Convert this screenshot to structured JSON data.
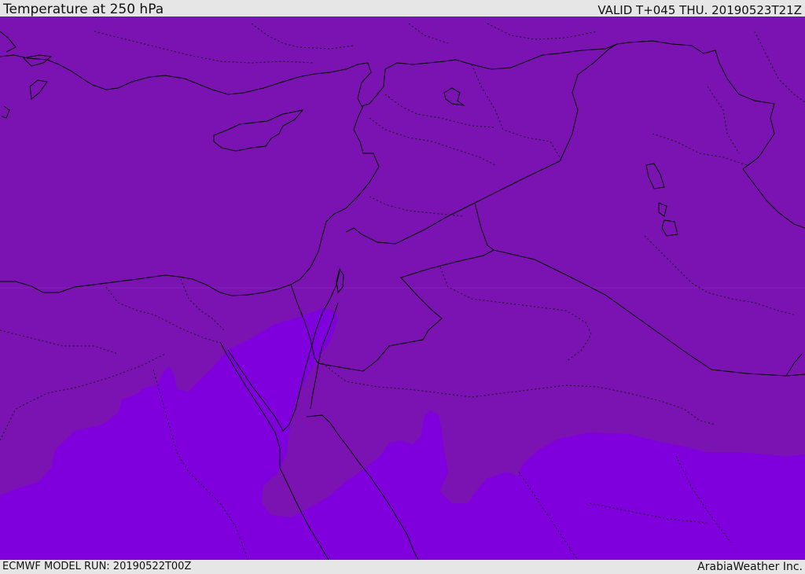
{
  "header": {
    "title": "Temperature at 250 hPa",
    "valid_time": "VALID T+045 THU. 20190523T21Z"
  },
  "footer": {
    "model_run": "ECMWF MODEL RUN: 20190522T00Z",
    "credit": "ArabiaWeather Inc."
  },
  "map": {
    "colors": {
      "band_cold": "#7b13b3",
      "band_warm": "#7f00dc",
      "coastline": "#000000",
      "border": "#000000",
      "admin_boundary": "#111111"
    }
  }
}
